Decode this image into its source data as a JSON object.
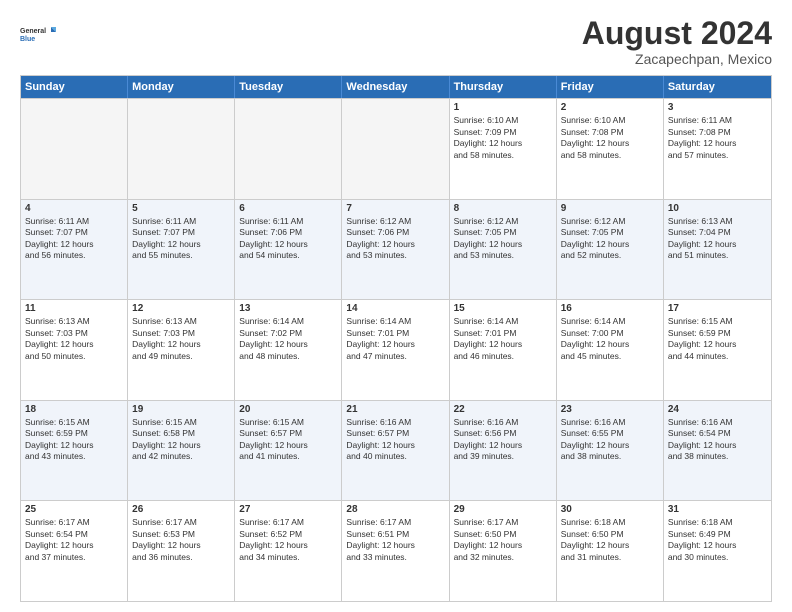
{
  "logo": {
    "general": "General",
    "blue": "Blue"
  },
  "title": "August 2024",
  "location": "Zacapechpan, Mexico",
  "days_of_week": [
    "Sunday",
    "Monday",
    "Tuesday",
    "Wednesday",
    "Thursday",
    "Friday",
    "Saturday"
  ],
  "weeks": [
    [
      {
        "day": "",
        "lines": [],
        "empty": true
      },
      {
        "day": "",
        "lines": [],
        "empty": true
      },
      {
        "day": "",
        "lines": [],
        "empty": true
      },
      {
        "day": "",
        "lines": [],
        "empty": true
      },
      {
        "day": "1",
        "lines": [
          "Sunrise: 6:10 AM",
          "Sunset: 7:09 PM",
          "Daylight: 12 hours",
          "and 58 minutes."
        ]
      },
      {
        "day": "2",
        "lines": [
          "Sunrise: 6:10 AM",
          "Sunset: 7:08 PM",
          "Daylight: 12 hours",
          "and 58 minutes."
        ]
      },
      {
        "day": "3",
        "lines": [
          "Sunrise: 6:11 AM",
          "Sunset: 7:08 PM",
          "Daylight: 12 hours",
          "and 57 minutes."
        ]
      }
    ],
    [
      {
        "day": "4",
        "lines": [
          "Sunrise: 6:11 AM",
          "Sunset: 7:07 PM",
          "Daylight: 12 hours",
          "and 56 minutes."
        ]
      },
      {
        "day": "5",
        "lines": [
          "Sunrise: 6:11 AM",
          "Sunset: 7:07 PM",
          "Daylight: 12 hours",
          "and 55 minutes."
        ]
      },
      {
        "day": "6",
        "lines": [
          "Sunrise: 6:11 AM",
          "Sunset: 7:06 PM",
          "Daylight: 12 hours",
          "and 54 minutes."
        ]
      },
      {
        "day": "7",
        "lines": [
          "Sunrise: 6:12 AM",
          "Sunset: 7:06 PM",
          "Daylight: 12 hours",
          "and 53 minutes."
        ]
      },
      {
        "day": "8",
        "lines": [
          "Sunrise: 6:12 AM",
          "Sunset: 7:05 PM",
          "Daylight: 12 hours",
          "and 53 minutes."
        ]
      },
      {
        "day": "9",
        "lines": [
          "Sunrise: 6:12 AM",
          "Sunset: 7:05 PM",
          "Daylight: 12 hours",
          "and 52 minutes."
        ]
      },
      {
        "day": "10",
        "lines": [
          "Sunrise: 6:13 AM",
          "Sunset: 7:04 PM",
          "Daylight: 12 hours",
          "and 51 minutes."
        ]
      }
    ],
    [
      {
        "day": "11",
        "lines": [
          "Sunrise: 6:13 AM",
          "Sunset: 7:03 PM",
          "Daylight: 12 hours",
          "and 50 minutes."
        ]
      },
      {
        "day": "12",
        "lines": [
          "Sunrise: 6:13 AM",
          "Sunset: 7:03 PM",
          "Daylight: 12 hours",
          "and 49 minutes."
        ]
      },
      {
        "day": "13",
        "lines": [
          "Sunrise: 6:14 AM",
          "Sunset: 7:02 PM",
          "Daylight: 12 hours",
          "and 48 minutes."
        ]
      },
      {
        "day": "14",
        "lines": [
          "Sunrise: 6:14 AM",
          "Sunset: 7:01 PM",
          "Daylight: 12 hours",
          "and 47 minutes."
        ]
      },
      {
        "day": "15",
        "lines": [
          "Sunrise: 6:14 AM",
          "Sunset: 7:01 PM",
          "Daylight: 12 hours",
          "and 46 minutes."
        ]
      },
      {
        "day": "16",
        "lines": [
          "Sunrise: 6:14 AM",
          "Sunset: 7:00 PM",
          "Daylight: 12 hours",
          "and 45 minutes."
        ]
      },
      {
        "day": "17",
        "lines": [
          "Sunrise: 6:15 AM",
          "Sunset: 6:59 PM",
          "Daylight: 12 hours",
          "and 44 minutes."
        ]
      }
    ],
    [
      {
        "day": "18",
        "lines": [
          "Sunrise: 6:15 AM",
          "Sunset: 6:59 PM",
          "Daylight: 12 hours",
          "and 43 minutes."
        ]
      },
      {
        "day": "19",
        "lines": [
          "Sunrise: 6:15 AM",
          "Sunset: 6:58 PM",
          "Daylight: 12 hours",
          "and 42 minutes."
        ]
      },
      {
        "day": "20",
        "lines": [
          "Sunrise: 6:15 AM",
          "Sunset: 6:57 PM",
          "Daylight: 12 hours",
          "and 41 minutes."
        ]
      },
      {
        "day": "21",
        "lines": [
          "Sunrise: 6:16 AM",
          "Sunset: 6:57 PM",
          "Daylight: 12 hours",
          "and 40 minutes."
        ]
      },
      {
        "day": "22",
        "lines": [
          "Sunrise: 6:16 AM",
          "Sunset: 6:56 PM",
          "Daylight: 12 hours",
          "and 39 minutes."
        ]
      },
      {
        "day": "23",
        "lines": [
          "Sunrise: 6:16 AM",
          "Sunset: 6:55 PM",
          "Daylight: 12 hours",
          "and 38 minutes."
        ]
      },
      {
        "day": "24",
        "lines": [
          "Sunrise: 6:16 AM",
          "Sunset: 6:54 PM",
          "Daylight: 12 hours",
          "and 38 minutes."
        ]
      }
    ],
    [
      {
        "day": "25",
        "lines": [
          "Sunrise: 6:17 AM",
          "Sunset: 6:54 PM",
          "Daylight: 12 hours",
          "and 37 minutes."
        ]
      },
      {
        "day": "26",
        "lines": [
          "Sunrise: 6:17 AM",
          "Sunset: 6:53 PM",
          "Daylight: 12 hours",
          "and 36 minutes."
        ]
      },
      {
        "day": "27",
        "lines": [
          "Sunrise: 6:17 AM",
          "Sunset: 6:52 PM",
          "Daylight: 12 hours",
          "and 34 minutes."
        ]
      },
      {
        "day": "28",
        "lines": [
          "Sunrise: 6:17 AM",
          "Sunset: 6:51 PM",
          "Daylight: 12 hours",
          "and 33 minutes."
        ]
      },
      {
        "day": "29",
        "lines": [
          "Sunrise: 6:17 AM",
          "Sunset: 6:50 PM",
          "Daylight: 12 hours",
          "and 32 minutes."
        ]
      },
      {
        "day": "30",
        "lines": [
          "Sunrise: 6:18 AM",
          "Sunset: 6:50 PM",
          "Daylight: 12 hours",
          "and 31 minutes."
        ]
      },
      {
        "day": "31",
        "lines": [
          "Sunrise: 6:18 AM",
          "Sunset: 6:49 PM",
          "Daylight: 12 hours",
          "and 30 minutes."
        ]
      }
    ]
  ]
}
